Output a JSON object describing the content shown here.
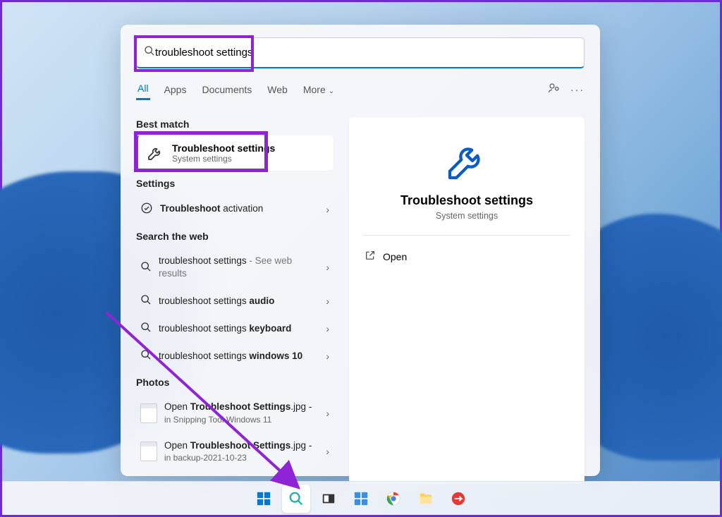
{
  "search": {
    "value": "troubleshoot settings"
  },
  "tabs": {
    "all": "All",
    "apps": "Apps",
    "documents": "Documents",
    "web": "Web",
    "more": "More"
  },
  "sections": {
    "best_match": "Best match",
    "settings": "Settings",
    "search_web": "Search the web",
    "photos": "Photos"
  },
  "best_match": {
    "title": "Troubleshoot settings",
    "subtitle": "System settings"
  },
  "settings_item": {
    "pre": "Troubleshoot",
    "suf": " activation"
  },
  "web": {
    "w1_pre": "troubleshoot settings",
    "w1_suf": " - See web results",
    "w2_pre": "troubleshoot settings ",
    "w2_bold": "audio",
    "w3_pre": "troubleshoot settings ",
    "w3_bold": "keyboard",
    "w4_pre": "troubleshoot settings ",
    "w4_bold": "windows 10"
  },
  "photos": {
    "p1_line1a": "Open ",
    "p1_line1b": "Troubleshoot Settings",
    "p1_line1c": ".jpg - ",
    "p1_line2": "in Snipping Tool Windows 11",
    "p2_line1a": "Open ",
    "p2_line1b": "Troubleshoot Settings",
    "p2_line1c": ".jpg - ",
    "p2_line2": "in backup-2021-10-23"
  },
  "preview": {
    "title": "Troubleshoot settings",
    "subtitle": "System settings",
    "open": "Open"
  }
}
